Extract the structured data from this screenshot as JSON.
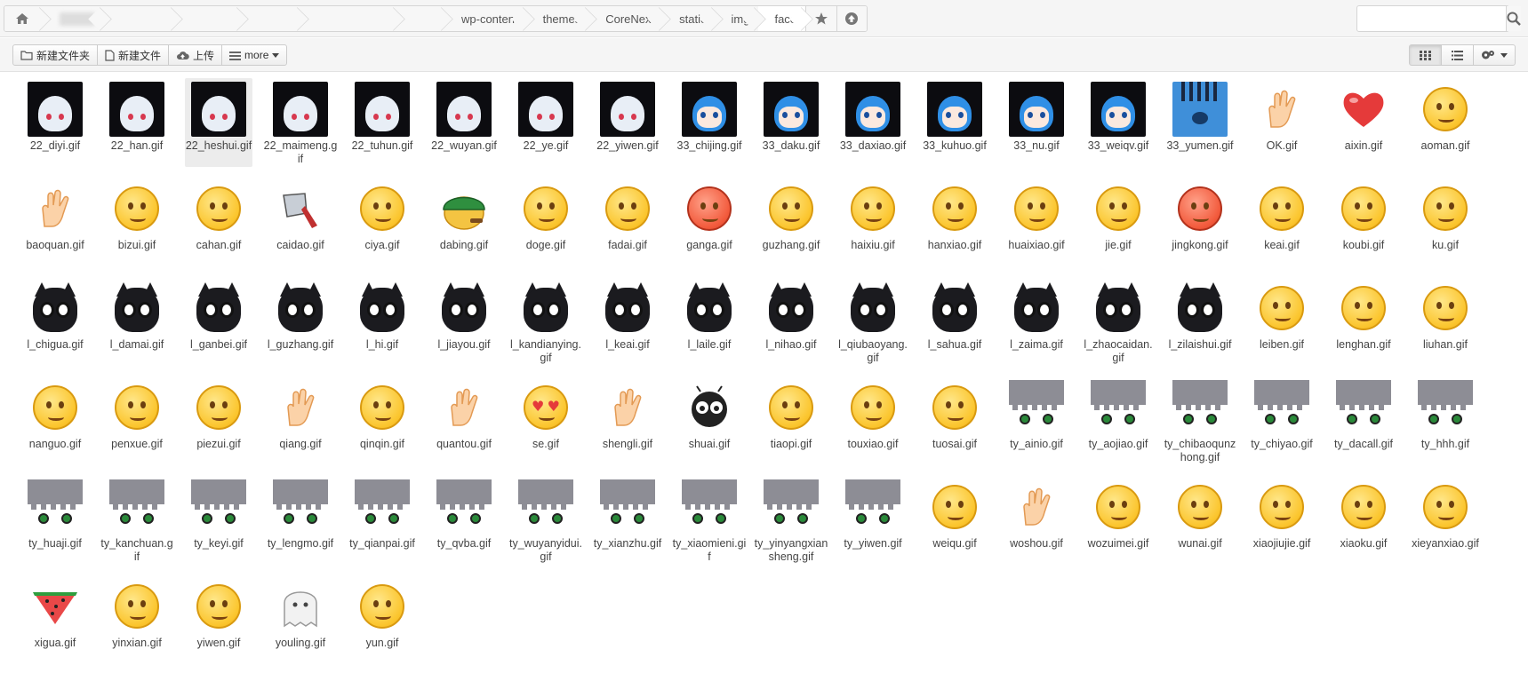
{
  "breadcrumb": {
    "blurred": [
      "...",
      "",
      "",
      "",
      "",
      ""
    ],
    "segments": [
      "wp-content",
      "themes",
      "CoreNext",
      "static",
      "img",
      "face"
    ]
  },
  "search": {
    "placeholder": ""
  },
  "toolbar": {
    "new_folder": "新建文件夹",
    "new_file": "新建文件",
    "upload": "上传",
    "more": "more"
  },
  "files": [
    {
      "name": "22_diyi.gif",
      "kind": "dark"
    },
    {
      "name": "22_han.gif",
      "kind": "dark"
    },
    {
      "name": "22_heshui.gif",
      "kind": "dark",
      "selected": true
    },
    {
      "name": "22_maimeng.gif",
      "kind": "dark"
    },
    {
      "name": "22_tuhun.gif",
      "kind": "dark"
    },
    {
      "name": "22_wuyan.gif",
      "kind": "dark"
    },
    {
      "name": "22_ye.gif",
      "kind": "dark"
    },
    {
      "name": "22_yiwen.gif",
      "kind": "dark"
    },
    {
      "name": "33_chijing.gif",
      "kind": "blue"
    },
    {
      "name": "33_daku.gif",
      "kind": "blue"
    },
    {
      "name": "33_daxiao.gif",
      "kind": "blue"
    },
    {
      "name": "33_kuhuo.gif",
      "kind": "blue"
    },
    {
      "name": "33_nu.gif",
      "kind": "blue"
    },
    {
      "name": "33_weiqv.gif",
      "kind": "blue"
    },
    {
      "name": "33_yumen.gif",
      "kind": "yumen"
    },
    {
      "name": "OK.gif",
      "kind": "hand"
    },
    {
      "name": "aixin.gif",
      "kind": "heart"
    },
    {
      "name": "aoman.gif",
      "kind": "emoji"
    },
    {
      "name": "baoquan.gif",
      "kind": "hand"
    },
    {
      "name": "bizui.gif",
      "kind": "emoji"
    },
    {
      "name": "cahan.gif",
      "kind": "emoji"
    },
    {
      "name": "caidao.gif",
      "kind": "knife"
    },
    {
      "name": "ciya.gif",
      "kind": "emoji"
    },
    {
      "name": "dabing.gif",
      "kind": "helmet"
    },
    {
      "name": "doge.gif",
      "kind": "emoji"
    },
    {
      "name": "fadai.gif",
      "kind": "emoji"
    },
    {
      "name": "ganga.gif",
      "kind": "emoji-red"
    },
    {
      "name": "guzhang.gif",
      "kind": "emoji"
    },
    {
      "name": "haixiu.gif",
      "kind": "emoji"
    },
    {
      "name": "hanxiao.gif",
      "kind": "emoji"
    },
    {
      "name": "huaixiao.gif",
      "kind": "emoji"
    },
    {
      "name": "jie.gif",
      "kind": "emoji"
    },
    {
      "name": "jingkong.gif",
      "kind": "emoji-red"
    },
    {
      "name": "keai.gif",
      "kind": "emoji"
    },
    {
      "name": "koubi.gif",
      "kind": "emoji"
    },
    {
      "name": "ku.gif",
      "kind": "emoji"
    },
    {
      "name": "l_chigua.gif",
      "kind": "cat"
    },
    {
      "name": "l_damai.gif",
      "kind": "cat"
    },
    {
      "name": "l_ganbei.gif",
      "kind": "cat"
    },
    {
      "name": "l_guzhang.gif",
      "kind": "cat"
    },
    {
      "name": "l_hi.gif",
      "kind": "cat"
    },
    {
      "name": "l_jiayou.gif",
      "kind": "cat"
    },
    {
      "name": "l_kandianying.gif",
      "kind": "cat"
    },
    {
      "name": "l_keai.gif",
      "kind": "cat"
    },
    {
      "name": "l_laile.gif",
      "kind": "cat"
    },
    {
      "name": "l_nihao.gif",
      "kind": "cat"
    },
    {
      "name": "l_qiubaoyang.gif",
      "kind": "cat"
    },
    {
      "name": "l_sahua.gif",
      "kind": "cat"
    },
    {
      "name": "l_zaima.gif",
      "kind": "cat"
    },
    {
      "name": "l_zhaocaidan.gif",
      "kind": "cat"
    },
    {
      "name": "l_zilaishui.gif",
      "kind": "cat"
    },
    {
      "name": "leiben.gif",
      "kind": "emoji"
    },
    {
      "name": "lenghan.gif",
      "kind": "emoji"
    },
    {
      "name": "liuhan.gif",
      "kind": "emoji"
    },
    {
      "name": "nanguo.gif",
      "kind": "emoji"
    },
    {
      "name": "penxue.gif",
      "kind": "emoji"
    },
    {
      "name": "piezui.gif",
      "kind": "emoji"
    },
    {
      "name": "qiang.gif",
      "kind": "hand"
    },
    {
      "name": "qinqin.gif",
      "kind": "emoji"
    },
    {
      "name": "quantou.gif",
      "kind": "hand"
    },
    {
      "name": "se.gif",
      "kind": "emoji-love"
    },
    {
      "name": "shengli.gif",
      "kind": "hand"
    },
    {
      "name": "shuai.gif",
      "kind": "bug"
    },
    {
      "name": "tiaopi.gif",
      "kind": "emoji"
    },
    {
      "name": "touxiao.gif",
      "kind": "emoji"
    },
    {
      "name": "tuosai.gif",
      "kind": "emoji"
    },
    {
      "name": "ty_ainio.gif",
      "kind": "anime"
    },
    {
      "name": "ty_aojiao.gif",
      "kind": "anime"
    },
    {
      "name": "ty_chibaoqunzhong.gif",
      "kind": "anime"
    },
    {
      "name": "ty_chiyao.gif",
      "kind": "anime"
    },
    {
      "name": "ty_dacall.gif",
      "kind": "anime"
    },
    {
      "name": "ty_hhh.gif",
      "kind": "anime"
    },
    {
      "name": "ty_huaji.gif",
      "kind": "anime"
    },
    {
      "name": "ty_kanchuan.gif",
      "kind": "anime"
    },
    {
      "name": "ty_keyi.gif",
      "kind": "anime"
    },
    {
      "name": "ty_lengmo.gif",
      "kind": "anime"
    },
    {
      "name": "ty_qianpai.gif",
      "kind": "anime"
    },
    {
      "name": "ty_qvba.gif",
      "kind": "anime"
    },
    {
      "name": "ty_wuyanyidui.gif",
      "kind": "anime"
    },
    {
      "name": "ty_xianzhu.gif",
      "kind": "anime"
    },
    {
      "name": "ty_xiaomieni.gif",
      "kind": "anime"
    },
    {
      "name": "ty_yinyangxiansheng.gif",
      "kind": "anime"
    },
    {
      "name": "ty_yiwen.gif",
      "kind": "anime"
    },
    {
      "name": "weiqu.gif",
      "kind": "emoji"
    },
    {
      "name": "woshou.gif",
      "kind": "hand"
    },
    {
      "name": "wozuimei.gif",
      "kind": "emoji"
    },
    {
      "name": "wunai.gif",
      "kind": "emoji"
    },
    {
      "name": "xiaojiujie.gif",
      "kind": "emoji"
    },
    {
      "name": "xiaoku.gif",
      "kind": "emoji"
    },
    {
      "name": "xieyanxiao.gif",
      "kind": "emoji"
    },
    {
      "name": "xigua.gif",
      "kind": "melon"
    },
    {
      "name": "yinxian.gif",
      "kind": "emoji"
    },
    {
      "name": "yiwen.gif",
      "kind": "emoji"
    },
    {
      "name": "youling.gif",
      "kind": "ghost"
    },
    {
      "name": "yun.gif",
      "kind": "emoji"
    }
  ]
}
